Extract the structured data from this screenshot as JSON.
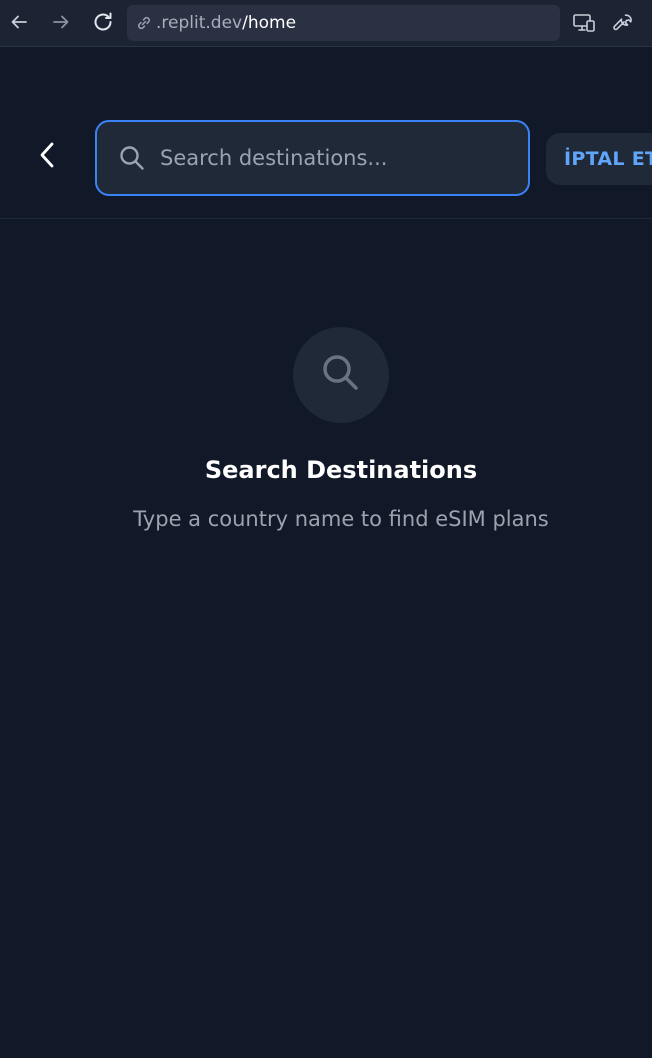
{
  "browser": {
    "url_prefix": ".replit.dev",
    "url_path": "/home",
    "icons": [
      "back-arrow-icon",
      "forward-arrow-icon",
      "reload-icon",
      "link-icon",
      "devices-icon",
      "wrench-icon"
    ]
  },
  "header": {
    "search": {
      "placeholder": "Search destinations...",
      "value": ""
    },
    "cancel_label": "İPTAL ET",
    "back_icon": "chevron-left-icon",
    "accent_color": "#3b82f6"
  },
  "empty_state": {
    "icon": "search-icon",
    "title": "Search Destinations",
    "subtitle": "Type a country name to find eSIM plans"
  },
  "colors": {
    "background": "#111827",
    "surface": "#1f2937",
    "accent": "#3b82f6",
    "link_text": "#60a5fa"
  }
}
